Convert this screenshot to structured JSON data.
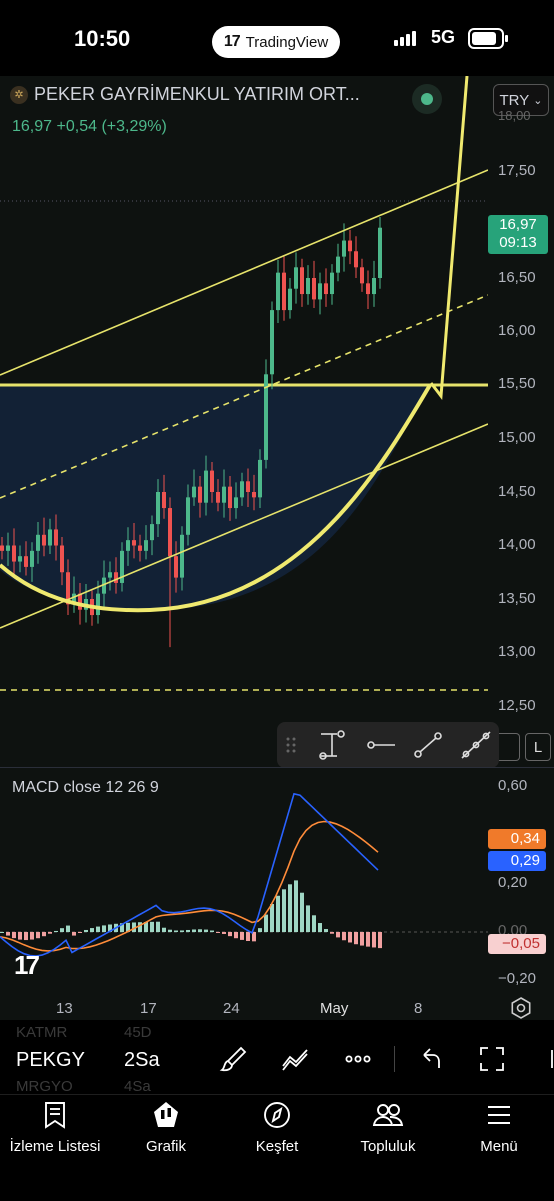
{
  "status": {
    "time": "10:50",
    "pill_label": "TradingView",
    "network": "5G"
  },
  "symbol": {
    "name": "PEKER GAYRİMENKUL YATIRIM ORT...",
    "last": "16,97",
    "change": "+0,54",
    "change_pct": "(+3,29%)",
    "currency": "TRY",
    "price_label": "16,97",
    "countdown": "09:13"
  },
  "price_axis": [
    "17,50",
    "17,00",
    "16,50",
    "16,00",
    "15,50",
    "15,00",
    "14,50",
    "14,00",
    "13,50",
    "13,00",
    "12,50"
  ],
  "drawing_tools": [
    "vertical-line-icon",
    "horizontal-ray-icon",
    "trend-line-icon",
    "multi-point-line-icon"
  ],
  "side_buttons": {
    "l": "L"
  },
  "macd": {
    "label": "MACD close  12  26  9",
    "axis": [
      "0,60",
      "0,40",
      "0,20",
      "0,00",
      "−0,20"
    ],
    "signal_value": "0,34",
    "macd_value": "0,29",
    "hist_value": "−0,05"
  },
  "time_axis": [
    "13",
    "17",
    "24",
    "May",
    "8"
  ],
  "bottom_toolbar": {
    "symbol": "PEKGY",
    "interval": "2Sa",
    "ghost_rows": [
      {
        "sym": "KATMR",
        "val": "45D"
      },
      {
        "sym": "MRGYO",
        "val": "4Sa"
      }
    ]
  },
  "nav": [
    "İzleme Listesi",
    "Grafik",
    "Keşfet",
    "Topluluk",
    "Menü"
  ],
  "colors": {
    "up": "#4db88b",
    "down": "#ef5350",
    "drawing": "#e6e36b",
    "macd_line": "#2962ff",
    "signal_line": "#ff6d00"
  }
}
